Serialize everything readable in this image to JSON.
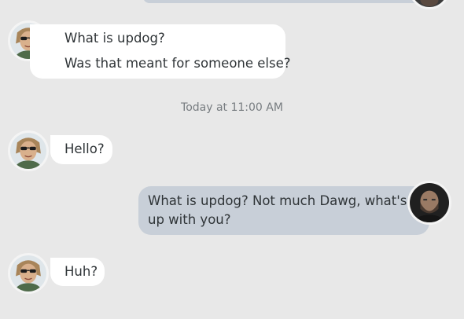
{
  "conversation": {
    "messages": [
      {
        "sender": "friend",
        "lines": [
          "What is updog?",
          "Was that meant for someone else?"
        ]
      },
      {
        "sender": "friend",
        "lines": [
          "Hello?"
        ]
      },
      {
        "sender": "me",
        "lines": [
          "What is updog? Not much Dawg, what's",
          "up with you?"
        ]
      },
      {
        "sender": "friend",
        "lines": [
          "Huh?"
        ]
      }
    ],
    "timestamp": "Today at 11:00 AM"
  },
  "avatars": {
    "friend_icon": "avatar-woman-sunglasses",
    "me_icon": "avatar-man-bearded"
  },
  "colors": {
    "background": "#e8e8e8",
    "incoming_bubble": "#ffffff",
    "outgoing_bubble": "#c8cfd8",
    "text": "#2f3437",
    "timestamp": "#777c80"
  }
}
